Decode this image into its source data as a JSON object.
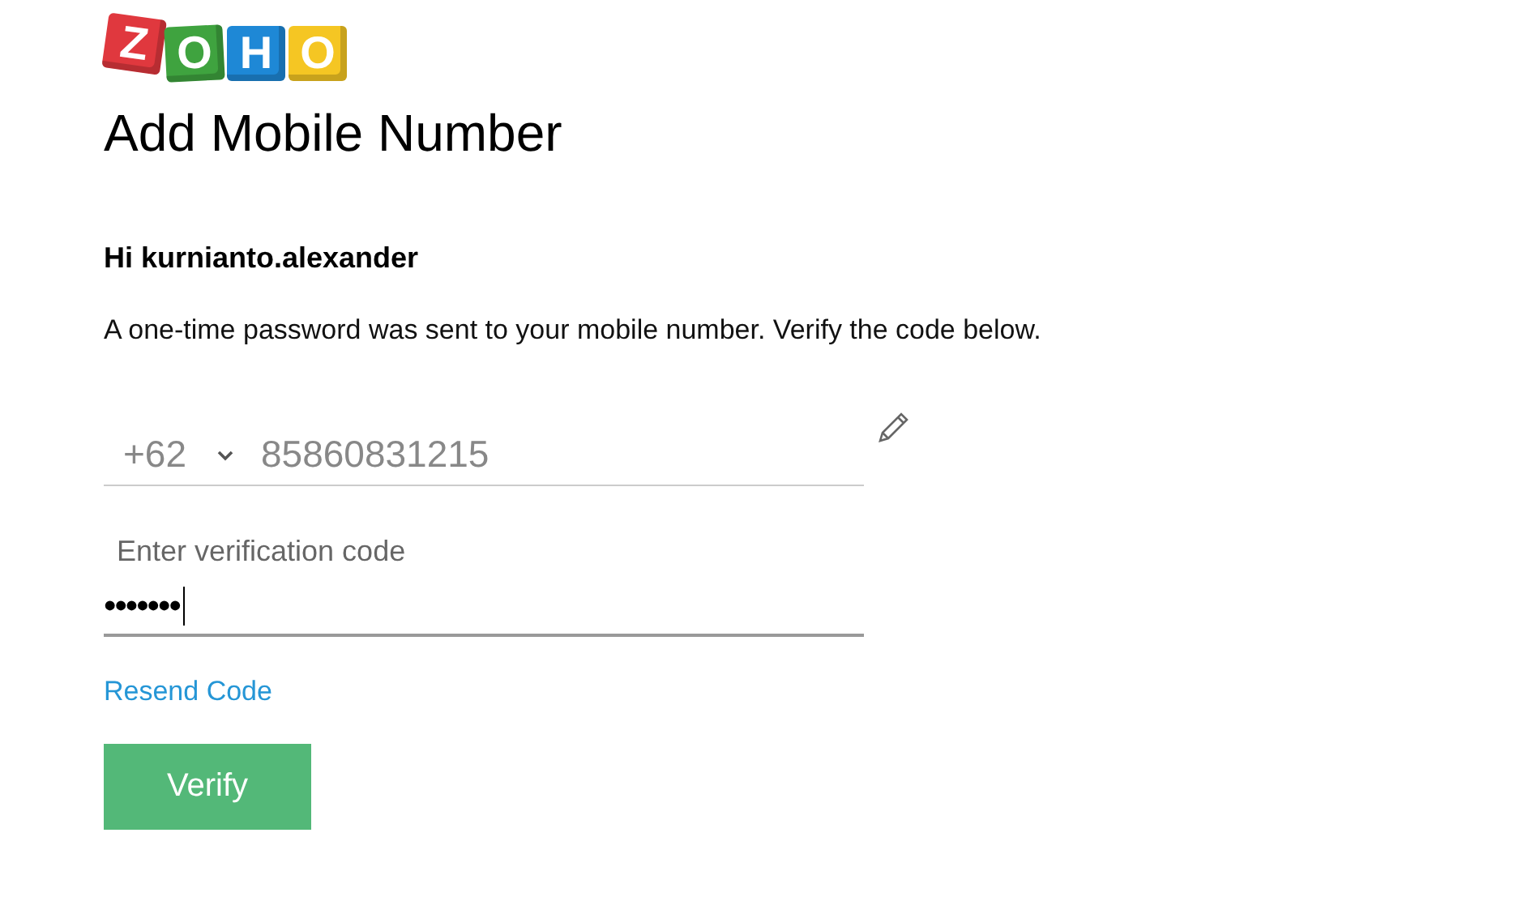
{
  "logo": {
    "letters": [
      {
        "char": "Z",
        "color": "#e0383e"
      },
      {
        "char": "O",
        "color": "#3fa33f"
      },
      {
        "char": "H",
        "color": "#1e88d6"
      },
      {
        "char": "O",
        "color": "#f5c623"
      }
    ]
  },
  "title": "Add Mobile Number",
  "greeting": "Hi kurnianto.alexander",
  "message": "A one-time password was sent to your mobile number. Verify the code below.",
  "phone": {
    "country_code": "+62",
    "number": "85860831215"
  },
  "code_field": {
    "label": "Enter verification code",
    "value": "•••••••",
    "focused": true
  },
  "resend_link": "Resend Code",
  "verify_button": "Verify"
}
